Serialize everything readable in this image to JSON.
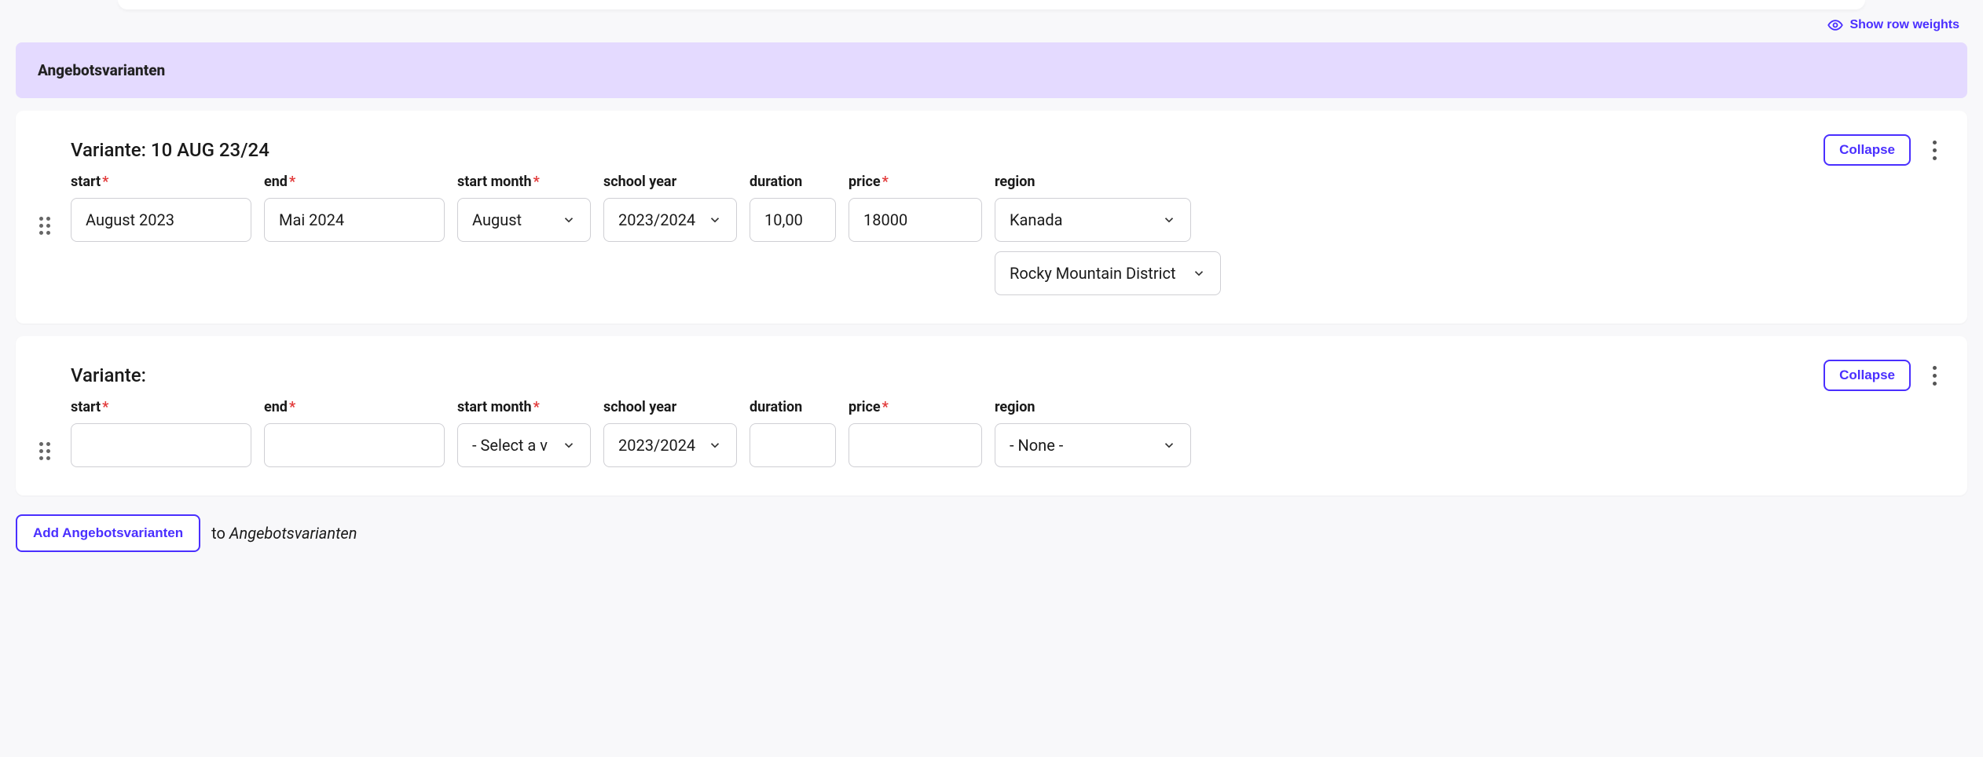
{
  "show_weights_label": "Show row weights",
  "section_title": "Angebotsvarianten",
  "collapse_label": "Collapse",
  "add_button_label": "Add Angebotsvarianten",
  "add_to_prefix": "to ",
  "add_to_target": "Angebotsvarianten",
  "labels": {
    "start": "start",
    "end": "end",
    "start_month": "start month",
    "school_year": "school year",
    "duration": "duration",
    "price": "price",
    "region": "region"
  },
  "variants": [
    {
      "title": "Variante: 10 AUG 23/24",
      "start": "August 2023",
      "end": "Mai 2024",
      "start_month": "August",
      "school_year": "2023/2024",
      "duration": "10,00",
      "price": "18000",
      "region": "Kanada",
      "district": "Rocky Mountain District"
    },
    {
      "title": "Variante:",
      "start": "",
      "end": "",
      "start_month": "- Select a v",
      "school_year": "2023/2024",
      "duration": "",
      "price": "",
      "region": "- None -",
      "district": null
    }
  ]
}
